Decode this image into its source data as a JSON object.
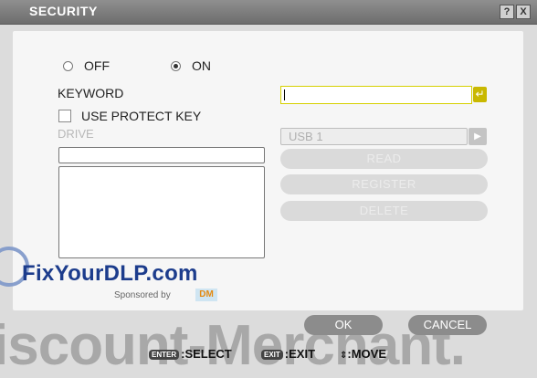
{
  "window": {
    "title": "SECURITY",
    "help_label": "?",
    "close_label": "X"
  },
  "security": {
    "off_label": "OFF",
    "on_label": "ON",
    "selected": "ON",
    "keyword_label": "KEYWORD",
    "keyword_value": "",
    "use_protect_key_label": "USE PROTECT KEY",
    "use_protect_key_checked": false,
    "drive_label": "DRIVE"
  },
  "usb": {
    "selected": "USB 1",
    "read_label": "READ",
    "register_label": "REGISTER",
    "delete_label": "DELETE"
  },
  "watermark": {
    "site": "FixYourDLP.com",
    "sponsored": "Sponsored by",
    "sponsor_logo": "DM",
    "merchant": "iscount-Merchant."
  },
  "buttons": {
    "ok": "OK",
    "cancel": "CANCEL"
  },
  "hints": {
    "enter_key": "ENTER",
    "select": ":SELECT",
    "exit_key": "EXIT",
    "exit": ":EXIT",
    "move_glyph": "⇕",
    "move": ":MOVE"
  },
  "colors": {
    "accent_yellow": "#d6d000",
    "enter_button": "#c9b800",
    "titlebar": "#7a7a7a"
  }
}
